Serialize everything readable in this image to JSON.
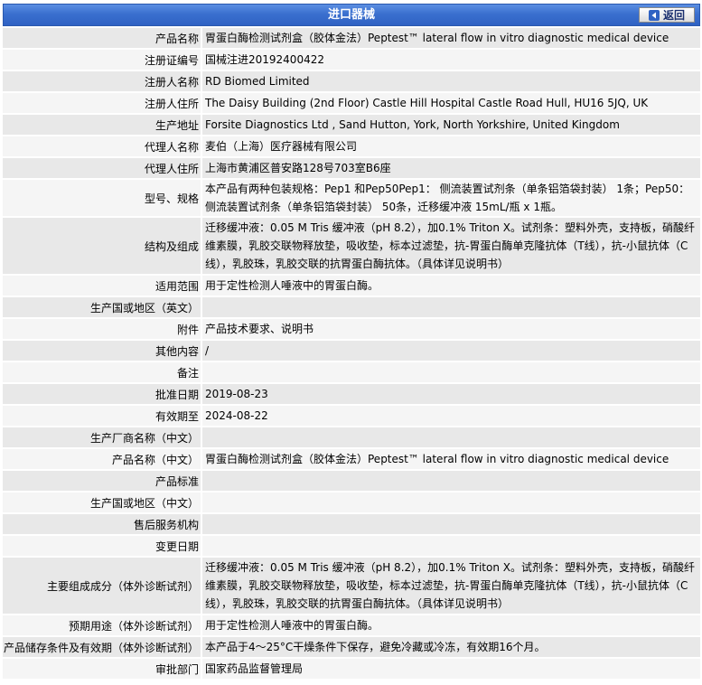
{
  "header": {
    "title": "进口器械",
    "back_label": "返回"
  },
  "rows": [
    {
      "label": "产品名称",
      "value": "胃蛋白酶检测试剂盒（胶体金法）Peptest™ lateral flow in vitro diagnostic medical device"
    },
    {
      "label": "注册证编号",
      "value": "国械注进20192400422"
    },
    {
      "label": "注册人名称",
      "value": "RD Biomed Limited"
    },
    {
      "label": "注册人住所",
      "value": "The Daisy Building (2nd Floor) Castle Hill Hospital Castle Road Hull, HU16 5JQ, UK"
    },
    {
      "label": "生产地址",
      "value": "Forsite Diagnostics Ltd , Sand Hutton, York, North Yorkshire, United Kingdom"
    },
    {
      "label": "代理人名称",
      "value": "麦伯（上海）医疗器械有限公司"
    },
    {
      "label": "代理人住所",
      "value": "上海市黄浦区普安路128号703室B6座"
    },
    {
      "label": "型号、规格",
      "value": "本产品有两种包装规格：Pep1 和Pep50Pep1： 侧流装置试剂条（单条铝箔袋封装） 1条；Pep50：侧流装置试剂条（单条铝箔袋封装） 50条，迁移缓冲液 15mL/瓶 x 1瓶。"
    },
    {
      "label": "结构及组成",
      "value": "迁移缓冲液：0.05 M Tris 缓冲液（pH 8.2），加0.1% Triton X。试剂条：塑料外壳，支持板，硝酸纤维素膜，乳胶交联物释放垫，吸收垫，标本过滤垫，抗-胃蛋白酶单克隆抗体（T线），抗-小鼠抗体（C线），乳胶珠，乳胶交联的抗胃蛋白酶抗体。（具体详见说明书）"
    },
    {
      "label": "适用范围",
      "value": "用于定性检测人唾液中的胃蛋白酶。"
    },
    {
      "label": "生产国或地区（英文）",
      "value": ""
    },
    {
      "label": "附件",
      "value": "产品技术要求、说明书"
    },
    {
      "label": "其他内容",
      "value": "/"
    },
    {
      "label": "备注",
      "value": ""
    },
    {
      "label": "批准日期",
      "value": "2019-08-23"
    },
    {
      "label": "有效期至",
      "value": "2024-08-22"
    },
    {
      "label": "生产厂商名称（中文）",
      "value": ""
    },
    {
      "label": "产品名称（中文）",
      "value": "胃蛋白酶检测试剂盒（胶体金法）Peptest™ lateral flow in vitro diagnostic medical device"
    },
    {
      "label": "产品标准",
      "value": ""
    },
    {
      "label": "生产国或地区（中文）",
      "value": ""
    },
    {
      "label": "售后服务机构",
      "value": ""
    },
    {
      "label": "变更日期",
      "value": ""
    },
    {
      "label": "主要组成成分（体外诊断试剂）",
      "value": "迁移缓冲液：0.05 M Tris 缓冲液（pH 8.2），加0.1% Triton X。试剂条：塑料外壳，支持板，硝酸纤维素膜，乳胶交联物释放垫，吸收垫，标本过滤垫，抗-胃蛋白酶单克隆抗体（T线），抗-小鼠抗体（C线），乳胶珠，乳胶交联的抗胃蛋白酶抗体。（具体详见说明书）"
    },
    {
      "label": "预期用途（体外诊断试剂）",
      "value": "用于定性检测人唾液中的胃蛋白酶。"
    },
    {
      "label": "产品储存条件及有效期（体外诊断试剂）",
      "value": "本产品于4～25°C干燥条件下保存，避免冷藏或冷冻，有效期16个月。"
    },
    {
      "label": "审批部门",
      "value": "国家药品监督管理局"
    }
  ]
}
